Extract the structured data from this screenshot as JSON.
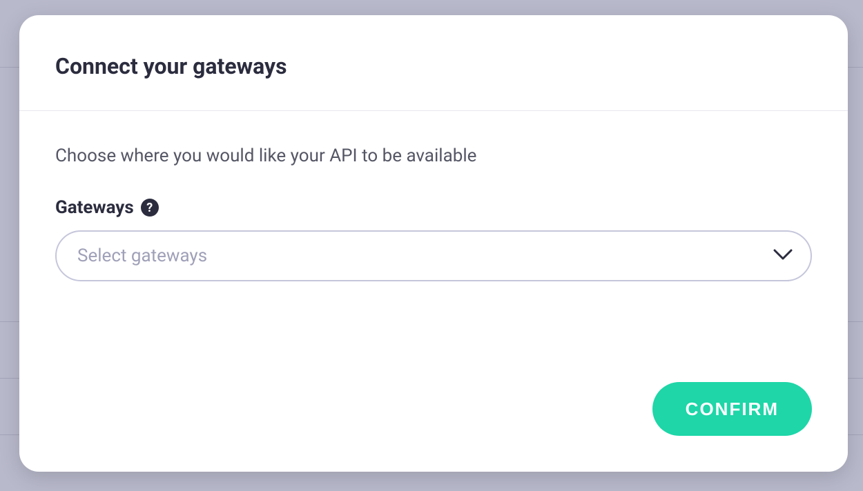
{
  "modal": {
    "title": "Connect your gateways",
    "description": "Choose where you would like your API to be available",
    "field_label": "Gateways",
    "select_placeholder": "Select gateways",
    "confirm_label": "CONFIRM"
  }
}
